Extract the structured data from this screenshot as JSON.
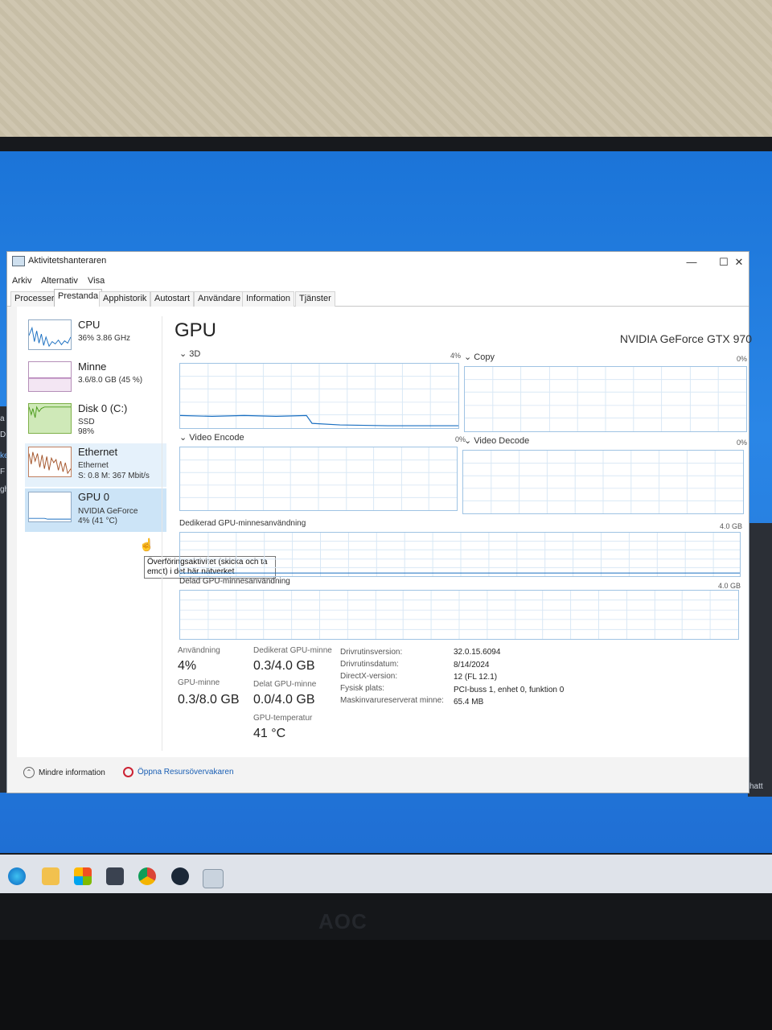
{
  "window": {
    "title": "Aktivitetshanteraren"
  },
  "menu": [
    "Arkiv",
    "Alternativ",
    "Visa"
  ],
  "tabs": [
    "Processer",
    "Prestanda",
    "Apphistorik",
    "Autostart",
    "Användare",
    "Information",
    "Tjänster"
  ],
  "active_tab": "Prestanda",
  "sidebar": [
    {
      "name": "CPU",
      "line1": "36% 3.86 GHz",
      "line2": "",
      "color": "#1a6fc1"
    },
    {
      "name": "Minne",
      "line1": "3.6/8.0 GB (45 %)",
      "line2": "",
      "color": "#8b3a8f"
    },
    {
      "name": "Disk 0 (C:)",
      "line1": "SSD",
      "line2": "98%",
      "color": "#4a9a1a"
    },
    {
      "name": "Ethernet",
      "line1": "Ethernet",
      "line2": "S: 0.8 M: 367 Mbit/s",
      "color": "#a3542a"
    },
    {
      "name": "GPU 0",
      "line1": "NVIDIA GeForce",
      "line2": "4% (41 °C)",
      "color": "#1a6fc1"
    }
  ],
  "tooltip": "Överföringsaktivitet (skicka och ta emot) i det här nätverket",
  "gpu": {
    "title": "GPU",
    "model": "NVIDIA GeForce GTX 970",
    "engines": [
      {
        "label": "3D",
        "pct": "4%"
      },
      {
        "label": "Copy",
        "pct": "0%"
      },
      {
        "label": "Video Encode",
        "pct": "0%"
      },
      {
        "label": "Video Decode",
        "pct": "0%"
      }
    ],
    "dedicated_label": "Dedikerad GPU-minnesanvändning",
    "dedicated_max": "4.0 GB",
    "shared_label": "Delad GPU-minnesanvändning",
    "shared_max": "4.0 GB",
    "stats": {
      "usage_label": "Användning",
      "usage": "4%",
      "gpu_mem_label": "GPU-minne",
      "gpu_mem": "0.3/8.0 GB",
      "dedicated_label": "Dedikerat GPU-minne",
      "dedicated": "0.3/4.0 GB",
      "shared_label": "Delat GPU-minne",
      "shared": "0.0/4.0 GB",
      "temp_label": "GPU-temperatur",
      "temp": "41 °C"
    },
    "info": [
      {
        "k": "Drivrutinsversion:",
        "v": "32.0.15.6094"
      },
      {
        "k": "Drivrutinsdatum:",
        "v": "8/14/2024"
      },
      {
        "k": "DirectX-version:",
        "v": "12 (FL 12.1)"
      },
      {
        "k": "Fysisk plats:",
        "v": "PCI-buss 1, enhet 0, funktion 0"
      },
      {
        "k": "Maskinvarureserverat minne:",
        "v": "65.4 MB"
      }
    ]
  },
  "footer": {
    "less": "Mindre information",
    "resmon": "Öppna Resursövervakaren"
  },
  "monitor_brand": "AOC",
  "side_fragments": [
    "a",
    "D:",
    "ke",
    "F",
    "gh"
  ],
  "right_fragment": "hatt",
  "accent": "#1a6fc1"
}
